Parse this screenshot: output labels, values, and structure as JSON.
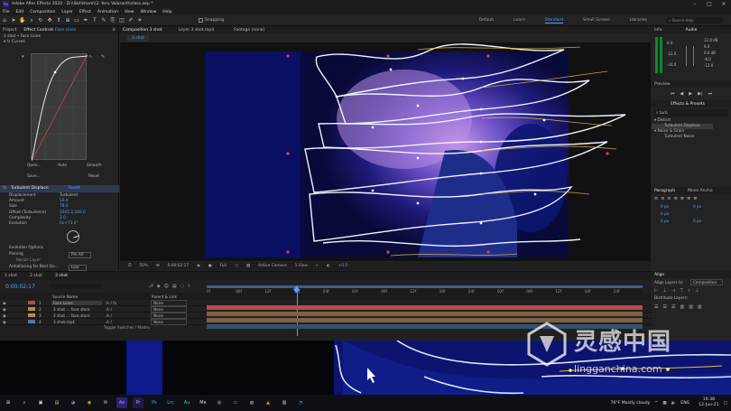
{
  "title": "Adobe After Effects 2020 - D:\\\\Skillshare\\\\3. Yeru Valorant\\\\class.aep *",
  "menu": [
    "File",
    "Edit",
    "Composition",
    "Layer",
    "Effect",
    "Animation",
    "View",
    "Window",
    "Help"
  ],
  "toolbar": {
    "snapping": "Snapping"
  },
  "workspaces": [
    "Default",
    "Learn",
    "Standard",
    "Small Screen",
    "Libraries"
  ],
  "active_workspace": "Standard",
  "search_help": "Search Help",
  "left": {
    "project_tab": "Project",
    "ec_tab": "Effect Controls",
    "ec_layer": "Face Lines",
    "ec_path": "3 shot • Face Lines",
    "curves": "Curves",
    "curve_buttons": [
      "Open...",
      "Auto",
      "Smooth",
      "Save...",
      "Reset"
    ],
    "effect": "Turbulent Displace",
    "reset": "Reset",
    "params": [
      {
        "label": "Displacement",
        "value": "Turbulent"
      },
      {
        "label": "Amount",
        "value": "50.0"
      },
      {
        "label": "Size",
        "value": "78.0"
      },
      {
        "label": "Offset (Turbulence)",
        "value": "1045.2,540.0"
      },
      {
        "label": "Complexity",
        "value": "2.0"
      },
      {
        "label": "Evolution",
        "value": "0x+73.0°"
      }
    ],
    "evo_options": "Evolution Options",
    "pinning": "Pinning",
    "pinning_val": "Pin All",
    "resize": "Resize Layer",
    "antialias": "Antialiasing for Best Qu...",
    "antialias_val": "Low"
  },
  "comp": {
    "tabs": [
      "Composition 3 shot",
      "Layer 3 shot.mp4",
      "Footage (none)"
    ],
    "subtab": "3 shot",
    "zoom": "50%",
    "time": "0:00:02:17",
    "res": "Full",
    "camera": "Active Camera",
    "view": "1 View",
    "exposure": "+0.0"
  },
  "right": {
    "info": "Info",
    "audio": "Audio",
    "db": [
      "0.0",
      "-12.0",
      "-24.0"
    ],
    "db_right": [
      "12.0 dB",
      "6.0",
      "0.0 dB",
      "-6.0",
      "-12.0"
    ],
    "preview": "Preview",
    "effects_presets": "Effects & Presets",
    "search": "turb",
    "distort": "Distort",
    "turb_displace": "Turbulent Displace",
    "noise": "Noise & Grain",
    "turb_noise": "Turbulent Noise",
    "paragraph": "Paragraph",
    "move_anchor": "Move Ancho",
    "para_vals": [
      "0 px",
      "0 px",
      "0 px",
      "0 px",
      "0 px"
    ],
    "align": "Align",
    "align_to": "Align Layers to:",
    "align_to_val": "Composition",
    "distribute": "Distribute Layers:"
  },
  "timeline": {
    "tabs": [
      "1 shot",
      "2 shot",
      "3 shot"
    ],
    "timecode": "0:00:02:17",
    "col_source": "Source Name",
    "col_parent": "Parent & Link",
    "layers": [
      {
        "num": "1",
        "name": "Face Lines",
        "parent": "None",
        "color": "#b64b4f"
      },
      {
        "num": "2",
        "name": "3 shot ... face store",
        "parent": "None",
        "color": "#c1874b"
      },
      {
        "num": "3",
        "name": "3 shot ... face store",
        "parent": "None",
        "color": "#c1874b"
      },
      {
        "num": "4",
        "name": "3 shot.mp4",
        "parent": "None",
        "color": "#4d7aa8"
      }
    ],
    "ruler": [
      "0f",
      "06f",
      "12f",
      "18f",
      "24f",
      "01f",
      "06f",
      "12f",
      "18f",
      "24f",
      "02f",
      "06f",
      "12f",
      "18f",
      "24f"
    ],
    "toggle": "Toggle Switches / Modes"
  },
  "taskbar": {
    "weather": "76°F Mostly cloudy",
    "lang": "ENG",
    "time": "16:38",
    "date": "12-Jun-21"
  },
  "watermark": {
    "cn": "灵感中国",
    "url": "lingganchina.com"
  }
}
